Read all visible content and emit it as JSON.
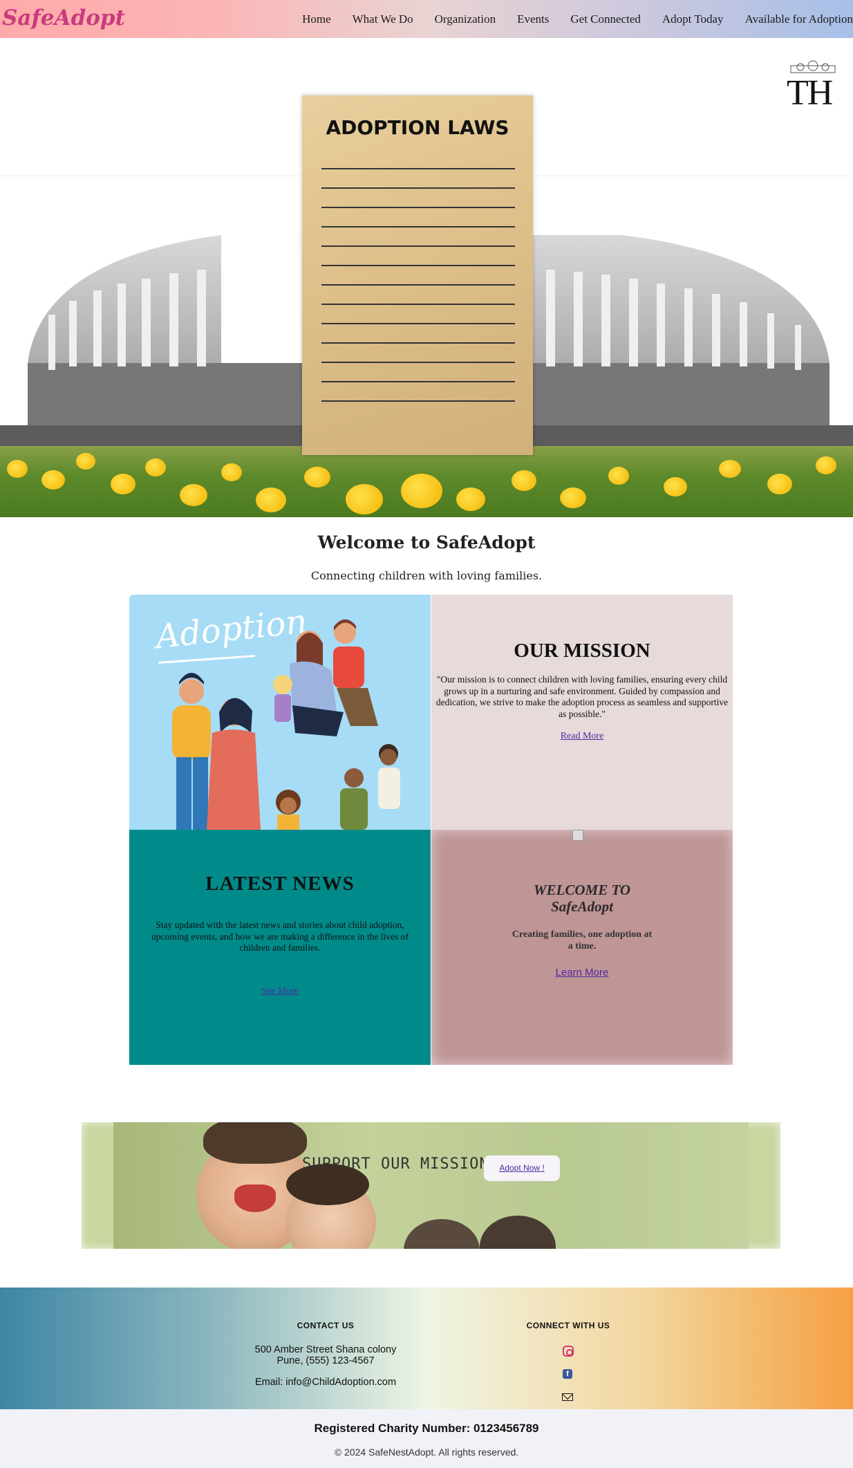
{
  "brand": {
    "logo": "SafeAdopt"
  },
  "nav": {
    "items": [
      {
        "label": "Home"
      },
      {
        "label": "What We Do"
      },
      {
        "label": "Organization"
      },
      {
        "label": "Events"
      },
      {
        "label": "Get Connected"
      },
      {
        "label": "Adopt Today"
      },
      {
        "label": "Available for Adoption"
      }
    ]
  },
  "hero": {
    "watermark": "TH",
    "paper_title": "ADOPTION LAWS"
  },
  "welcome": {
    "title": "Welcome to SafeAdopt",
    "subtitle": "Connecting children with loving families."
  },
  "grid": {
    "illustration_word": "Adoption",
    "mission": {
      "title": "OUR MISSION",
      "text": "\"Our mission is to connect children with loving families, ensuring every child grows up in a nurturing and safe environment. Guided by compassion and dedication, we strive to make the adoption process as seamless and supportive as possible.\"",
      "link": "Read More"
    },
    "news": {
      "title": "LATEST NEWS",
      "text": "Stay updated with the latest news and stories about child adoption, upcoming events, and how we are making a difference in the lives of children and families.",
      "link": "See More"
    },
    "welcome_card": {
      "title_line1": "WELCOME TO",
      "title_line2": "SafeAdopt",
      "text_line1": "Creating families, one adoption at",
      "text_line2": "a time.",
      "link": "Learn More"
    }
  },
  "banner": {
    "title": "SUPPORT OUR MISSION",
    "button": "Adopt Now !"
  },
  "footer": {
    "contact_heading": "CONTACT US",
    "address_line1": "500 Amber Street Shana colony",
    "address_line2": "Pune, (555) 123-4567",
    "email": "Email: info@ChildAdoption.com",
    "connect_heading": "CONNECT WITH US",
    "icons": [
      "instagram-icon",
      "facebook-icon",
      "mail-icon"
    ],
    "charity": "Registered Charity Number: 0123456789",
    "copyright": "© 2024 SafeNestAdopt. All rights reserved."
  },
  "colors": {
    "logo": "#c83b7e",
    "teal": "#008b8a",
    "mauve": "#bf9596",
    "link": "#4e2aa0"
  }
}
